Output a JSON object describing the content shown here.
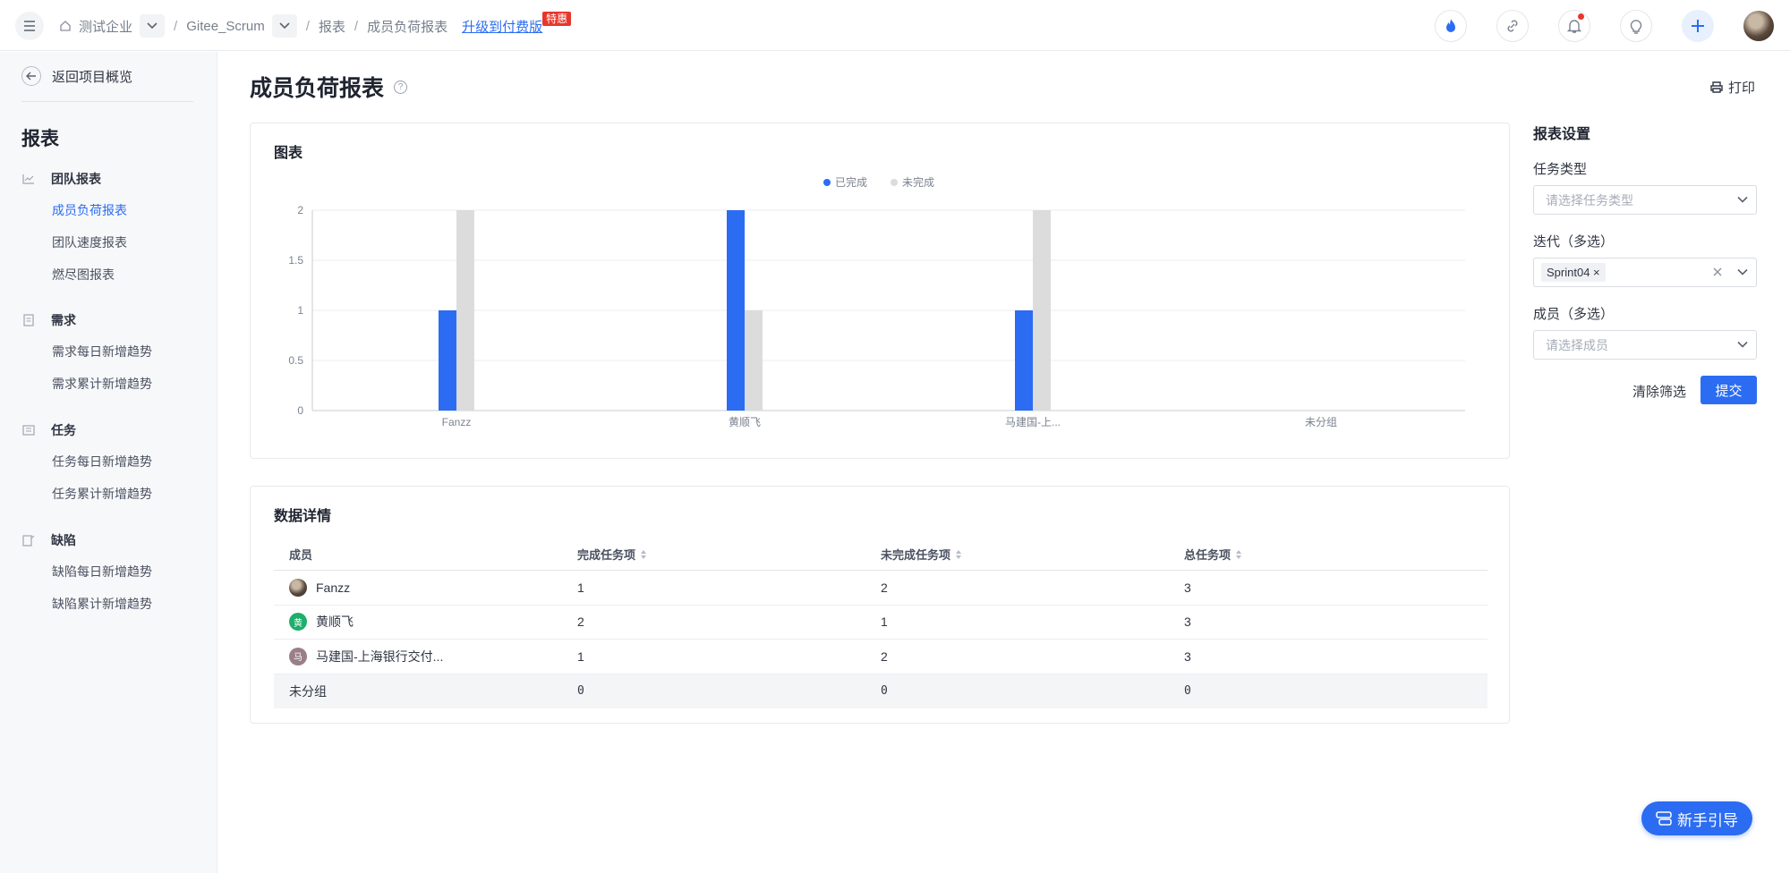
{
  "breadcrumb": {
    "company": "测试企业",
    "project": "Gitee_Scrum",
    "section": "报表",
    "current": "成员负荷报表",
    "upgrade": "升级到付费版",
    "hot_badge": "特惠"
  },
  "sidebar": {
    "back": "返回项目概览",
    "title": "报表",
    "groups": [
      {
        "label": "团队报表",
        "items": [
          "成员负荷报表",
          "团队速度报表",
          "燃尽图报表"
        ]
      },
      {
        "label": "需求",
        "items": [
          "需求每日新增趋势",
          "需求累计新增趋势"
        ]
      },
      {
        "label": "任务",
        "items": [
          "任务每日新增趋势",
          "任务累计新增趋势"
        ]
      },
      {
        "label": "缺陷",
        "items": [
          "缺陷每日新增趋势",
          "缺陷累计新增趋势"
        ]
      }
    ]
  },
  "page": {
    "title": "成员负荷报表",
    "help": "?",
    "print": "打印"
  },
  "chart_card": {
    "title": "图表"
  },
  "chart_data": {
    "type": "bar",
    "categories": [
      "Fanzz",
      "黄顺飞",
      "马建国-上...",
      "未分组"
    ],
    "series": [
      {
        "name": "已完成",
        "values": [
          1,
          2,
          1,
          0
        ],
        "color": "#2b6cf2"
      },
      {
        "name": "未完成",
        "values": [
          2,
          1,
          2,
          0
        ],
        "color": "#dcdcdc"
      }
    ],
    "y_ticks": [
      "0",
      "0.5",
      "1",
      "1.5",
      "2"
    ],
    "ylim": [
      0,
      2
    ],
    "grid": true,
    "legend_position": "top-center"
  },
  "table": {
    "title": "数据详情",
    "columns": [
      "成员",
      "完成任务项",
      "未完成任务项",
      "总任务项"
    ],
    "rows": [
      {
        "member": "Fanzz",
        "avatar_text": "",
        "done": "1",
        "undone": "2",
        "total": "3"
      },
      {
        "member": "黄顺飞",
        "avatar_text": "黄",
        "done": "2",
        "undone": "1",
        "total": "3"
      },
      {
        "member": "马建国-上海银行交付...",
        "avatar_text": "马",
        "done": "1",
        "undone": "2",
        "total": "3"
      },
      {
        "member": "未分组",
        "avatar_text": "",
        "done": "0",
        "undone": "0",
        "total": "0"
      }
    ]
  },
  "settings": {
    "title": "报表设置",
    "task_type_label": "任务类型",
    "task_type_placeholder": "请选择任务类型",
    "iteration_label": "迭代（多选）",
    "iteration_tag": "Sprint04 ×",
    "member_label": "成员（多选）",
    "member_placeholder": "请选择成员",
    "clear": "清除筛选",
    "submit": "提交"
  },
  "guide": "新手引导",
  "colors": {
    "accent": "#2b6cf2",
    "undone": "#dcdcdc",
    "badge": "#e8362b"
  }
}
